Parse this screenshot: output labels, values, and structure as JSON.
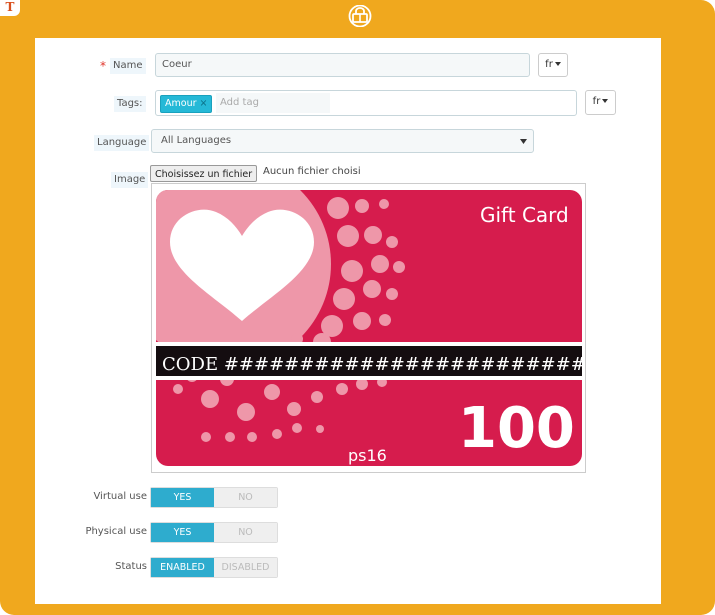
{
  "form": {
    "name_label": "Name",
    "required_mark": "*",
    "name_value": "Coeur",
    "lang_code": "fr",
    "tags_label": "Tags:",
    "tag_chip": "Amour",
    "tag_remove": "×",
    "tag_placeholder": "Add tag",
    "language_label": "Language",
    "language_value": "All Languages",
    "image_label": "Image",
    "file_button": "Choisissez un fichier",
    "file_status": "Aucun fichier choisi"
  },
  "card": {
    "title": "Gift Card",
    "code_text": "CODE #########################",
    "amount": "100",
    "theme": "ps16",
    "colors": {
      "main": "#d61c4d",
      "light": "#ee97a9",
      "stripe": "#140d10"
    }
  },
  "toggles": [
    {
      "label": "Virtual use",
      "on": "YES",
      "off": "NO"
    },
    {
      "label": "Physical use",
      "on": "YES",
      "off": "NO"
    },
    {
      "label": "Status",
      "on": "ENABLED",
      "off": "DISABLED"
    }
  ],
  "colors": {
    "frame": "#f0a81e",
    "accent": "#2eacce",
    "tag": "#25b9d7"
  }
}
